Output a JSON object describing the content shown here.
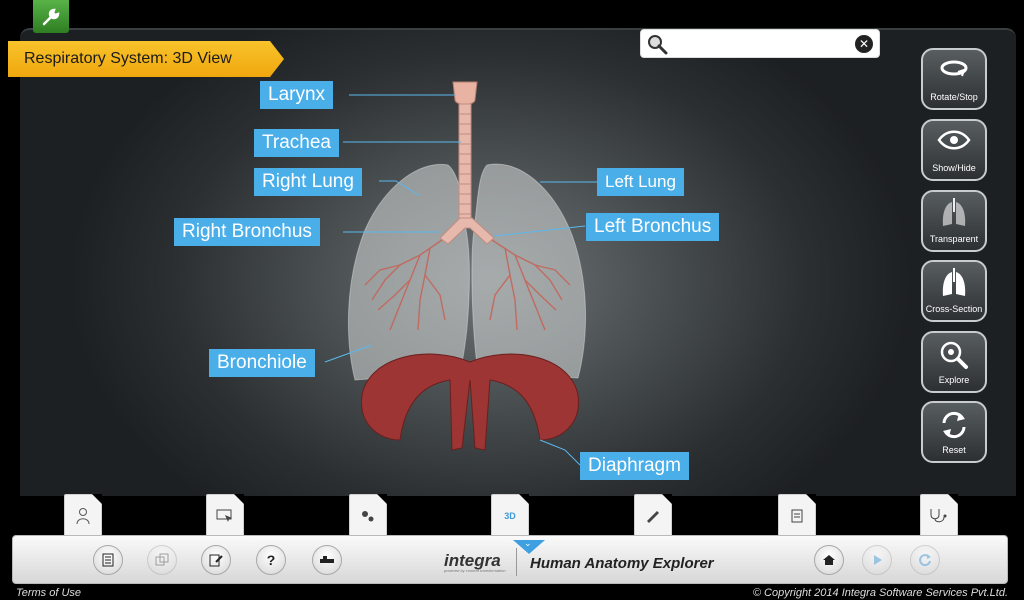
{
  "header": {
    "title": "Respiratory System: 3D View"
  },
  "search": {
    "placeholder": "",
    "value": ""
  },
  "side_buttons": [
    {
      "label": "Rotate/Stop",
      "icon": "rotate-icon"
    },
    {
      "label": "Show/Hide",
      "icon": "eye-icon"
    },
    {
      "label": "Transparent",
      "icon": "transparent-lungs-icon"
    },
    {
      "label": "Cross-Section",
      "icon": "cross-section-lungs-icon"
    },
    {
      "label": "Explore",
      "icon": "magnifier-icon"
    },
    {
      "label": "Reset",
      "icon": "reset-icon"
    }
  ],
  "labels": {
    "larynx": "Larynx",
    "trachea": "Trachea",
    "right_lung": "Right Lung",
    "left_lung": "Left Lung",
    "right_bronchus": "Right Bronchus",
    "left_bronchus": "Left Bronchus",
    "bronchiole": "Bronchiole",
    "diaphragm": "Diaphragm"
  },
  "tabs": [
    {
      "icon": "person-icon"
    },
    {
      "icon": "monitor-pointer-icon"
    },
    {
      "icon": "gears-icon"
    },
    {
      "icon": "3d-icon",
      "text": "3D"
    },
    {
      "icon": "pen-write-icon"
    },
    {
      "icon": "notes-icon"
    },
    {
      "icon": "stethoscope-icon"
    }
  ],
  "bottom_bar": {
    "brand": "integra",
    "brand_tagline": "powered by content transformation",
    "app_name": "Human Anatomy Explorer",
    "help_label": "?"
  },
  "footer": {
    "terms": "Terms of Use",
    "copyright": "© Copyright 2014 Integra Software Services Pvt.Ltd."
  },
  "colors": {
    "label_bg": "#4aaee9",
    "banner": "#f5b51c",
    "tool_green": "#3f9a30"
  }
}
